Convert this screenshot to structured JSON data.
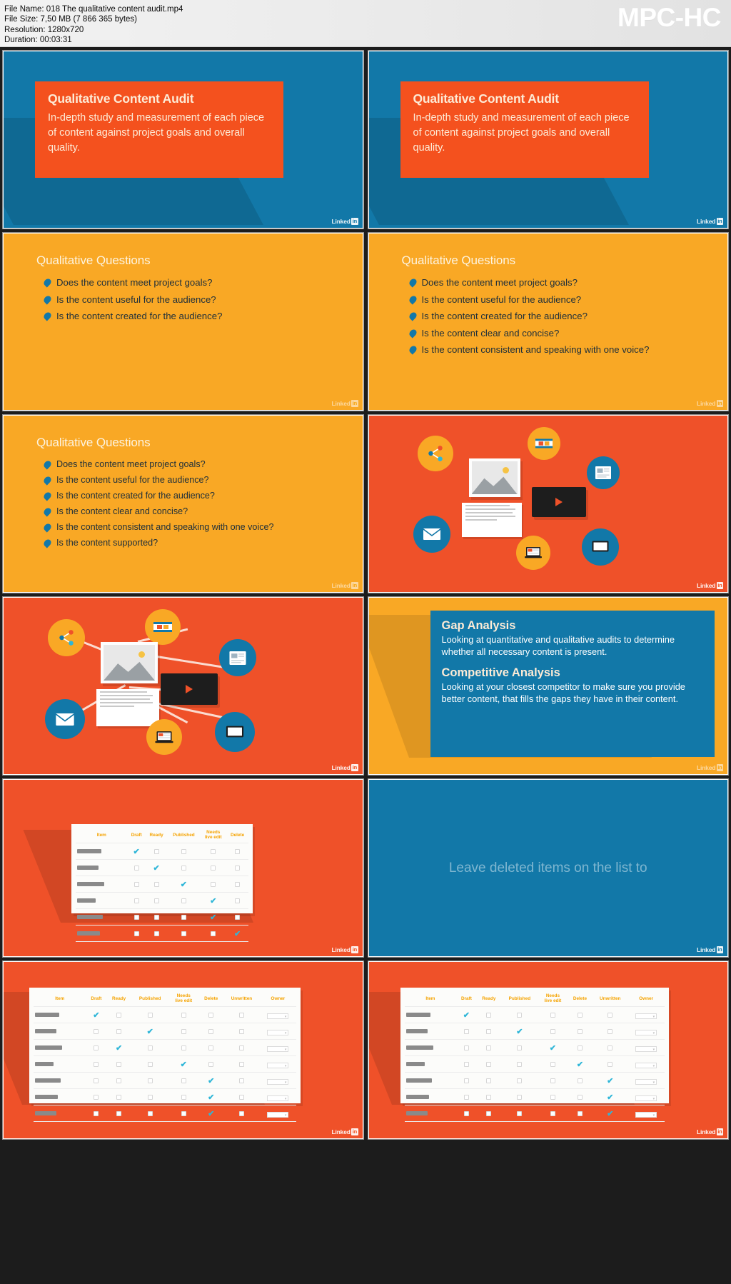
{
  "header": {
    "app_name": "MPC-HC",
    "file_name_label": "File Name: 018 The qualitative content audit.mp4",
    "file_size_label": "File Size: 7,50 MB (7 866 365 bytes)",
    "resolution_label": "Resolution: 1280x720",
    "duration_label": "Duration: 00:03:31"
  },
  "branding": {
    "linkedin_word": "Linked",
    "linkedin_in": "in"
  },
  "colors": {
    "blue": "#1278a8",
    "orange": "#ef5129",
    "orange_card": "#f4511e",
    "yellow": "#f9a825",
    "cream": "#fdebd6",
    "check_teal": "#2eb6d8",
    "header_bg": "#eaeaea"
  },
  "slides": [
    {
      "id": "slide-1",
      "kind": "title-card",
      "title": "Qualitative Content Audit",
      "body": "In-depth study and measurement of each piece of content against project goals and overall quality."
    },
    {
      "id": "slide-2",
      "kind": "title-card",
      "title": "Qualitative Content Audit",
      "body": "In-depth study and measurement of each piece of content against project goals and overall quality."
    },
    {
      "id": "slide-3",
      "kind": "bullets",
      "title": "Qualitative Questions",
      "bullets": [
        "Does the content meet project goals?",
        "Is the content useful for the audience?",
        "Is the content created for the audience?"
      ]
    },
    {
      "id": "slide-4",
      "kind": "bullets",
      "title": "Qualitative Questions",
      "bullets": [
        "Does the content meet project goals?",
        "Is the content useful for the audience?",
        "Is the content created for the audience?",
        "Is the content clear and concise?",
        "Is the content consistent and speaking with one voice?"
      ]
    },
    {
      "id": "slide-5",
      "kind": "bullets",
      "title": "Qualitative Questions",
      "bullets": [
        "Does the content meet project goals?",
        "Is the content useful for the audience?",
        "Is the content created for the audience?",
        "Is the content clear and concise?",
        "Is the content consistent and speaking with one voice?",
        "Is the content supported?"
      ]
    },
    {
      "id": "slide-6",
      "kind": "icon-network",
      "icon_names": [
        "share-icon",
        "film-strip-icon",
        "news-article-icon",
        "photo-icon",
        "video-player-icon",
        "document-icon",
        "email-envelope-icon",
        "laptop-icon",
        "monitor-icon"
      ]
    },
    {
      "id": "slide-7",
      "kind": "icon-network-connected",
      "icon_names": [
        "share-icon",
        "film-strip-icon",
        "news-article-icon",
        "photo-icon",
        "video-player-icon",
        "document-icon",
        "email-envelope-icon",
        "laptop-icon",
        "monitor-icon"
      ]
    },
    {
      "id": "slide-8",
      "kind": "gap-analysis",
      "heading_1": "Gap Analysis",
      "body_1": "Looking at quantitative and qualitative audits to determine whether all necessary content is present.",
      "heading_2": "Competitive Analysis",
      "body_2": "Looking at your closest competitor to make sure you provide better content, that fills the gaps they have in their content."
    },
    {
      "id": "slide-9",
      "kind": "checklist-table-6",
      "columns": [
        "Item",
        "Draft",
        "Ready",
        "Published",
        "Needs\nlive edit",
        "Delete"
      ],
      "rows": [
        {
          "checked_column": 1
        },
        {
          "checked_column": 2
        },
        {
          "checked_column": 3
        },
        {
          "checked_column": 4
        },
        {
          "checked_column": 4
        },
        {
          "checked_column": 5
        }
      ]
    },
    {
      "id": "slide-10",
      "kind": "fade-text",
      "text": "Leave deleted items on the list to"
    },
    {
      "id": "slide-11",
      "kind": "checklist-table-8",
      "columns": [
        "Item",
        "Draft",
        "Ready",
        "Published",
        "Needs\nlive edit",
        "Delete",
        "Unwritten",
        "Owner"
      ],
      "rows": [
        {
          "checked_column": 1
        },
        {
          "checked_column": 3
        },
        {
          "checked_column": 2
        },
        {
          "checked_column": 4
        },
        {
          "checked_column": 5
        },
        {
          "checked_column": 5
        },
        {
          "checked_column": 5
        }
      ]
    },
    {
      "id": "slide-12",
      "kind": "checklist-table-8",
      "columns": [
        "Item",
        "Draft",
        "Ready",
        "Published",
        "Needs\nlive edit",
        "Delete",
        "Unwritten",
        "Owner"
      ],
      "rows": [
        {
          "checked_column": 1
        },
        {
          "checked_column": 3
        },
        {
          "checked_column": 4
        },
        {
          "checked_column": 5
        },
        {
          "checked_column": 6
        },
        {
          "checked_column": 6
        },
        {
          "checked_column": 6
        }
      ]
    }
  ]
}
